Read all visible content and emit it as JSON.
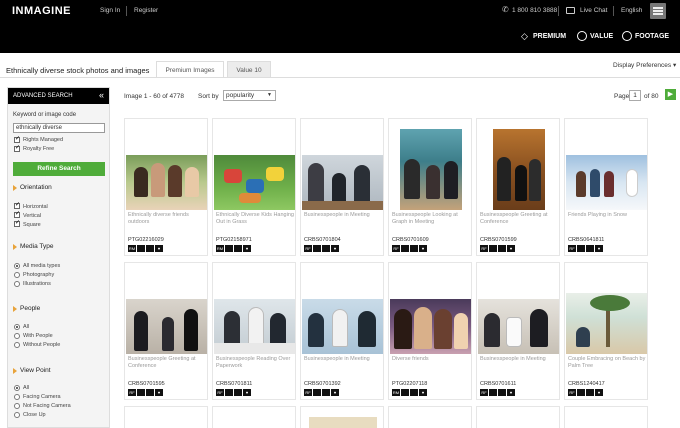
{
  "topbar": {
    "logo": "INMAGINE",
    "sign_in": "Sign In",
    "register": "Register",
    "phone": "1 800 810 3888",
    "live_chat": "Live Chat",
    "language": "English"
  },
  "products": {
    "premium": "PREMIUM",
    "value": "VALUE",
    "footage": "FOOTAGE"
  },
  "header": {
    "page_title": "Ethnically diverse stock photos and images",
    "tab_premium": "Premium Images",
    "tab_value": "Value 10",
    "display_prefs": "Display Preferences"
  },
  "sidebar": {
    "title": "ADVANCED SEARCH",
    "keyword_label": "Keyword or image code",
    "keyword_value": "ethnically diverse",
    "rights_managed": "Rights Managed",
    "royalty_free": "Royalty Free",
    "refine_button": "Refine Search",
    "orientation_title": "Orientation",
    "orientation": [
      "Horizontal",
      "Vertical",
      "Square"
    ],
    "media_title": "Media Type",
    "media": [
      "All media types",
      "Photography",
      "Illustrations"
    ],
    "people_title": "People",
    "people": [
      "All",
      "With People",
      "Without People"
    ],
    "viewpoint_title": "View Point",
    "viewpoint": [
      "All",
      "Facing Camera",
      "Not Facing Camera",
      "Close Up"
    ]
  },
  "results": {
    "count": "Image 1 - 60 of 4778",
    "sort_label": "Sort by",
    "sort_value": "popularity",
    "page_label": "Page",
    "page_value": "1",
    "page_of": "of 80"
  },
  "cards": [
    {
      "caption": "Ethnically diverse friends outdoors",
      "code": "PTG02216029",
      "badge": "RM"
    },
    {
      "caption": "Ethnically Diverse Kids Hanging Out in Grass",
      "code": "PTG02158971",
      "badge": "RM"
    },
    {
      "caption": "Businesspeople in Meeting",
      "code": "CRBS0701804",
      "badge": "RF"
    },
    {
      "caption": "Businesspeople Looking at Graph in Meeting",
      "code": "CRBS0701609",
      "badge": "RF"
    },
    {
      "caption": "Businesspeople Greeting at Conference",
      "code": "CRBS0701599",
      "badge": "RF"
    },
    {
      "caption": "Friends Playing in Snow",
      "code": "CRBS0641811",
      "badge": "RF"
    },
    {
      "caption": "Businesspeople Greeting at Conference",
      "code": "CRBS0701595",
      "badge": "RF"
    },
    {
      "caption": "Businesspeople Reading Over Paperwork",
      "code": "CRBS0701811",
      "badge": "RF"
    },
    {
      "caption": "Businesspeople in Meeting",
      "code": "CRBS0701392",
      "badge": "RF"
    },
    {
      "caption": "Diverse friends",
      "code": "PTG02207118",
      "badge": "RM"
    },
    {
      "caption": "Businesspeople in Meeting",
      "code": "CRBS0701611",
      "badge": "RF"
    },
    {
      "caption": "Couple Embracing on Beach by Palm Tree",
      "code": "CRBS1240417",
      "badge": "RF"
    }
  ]
}
